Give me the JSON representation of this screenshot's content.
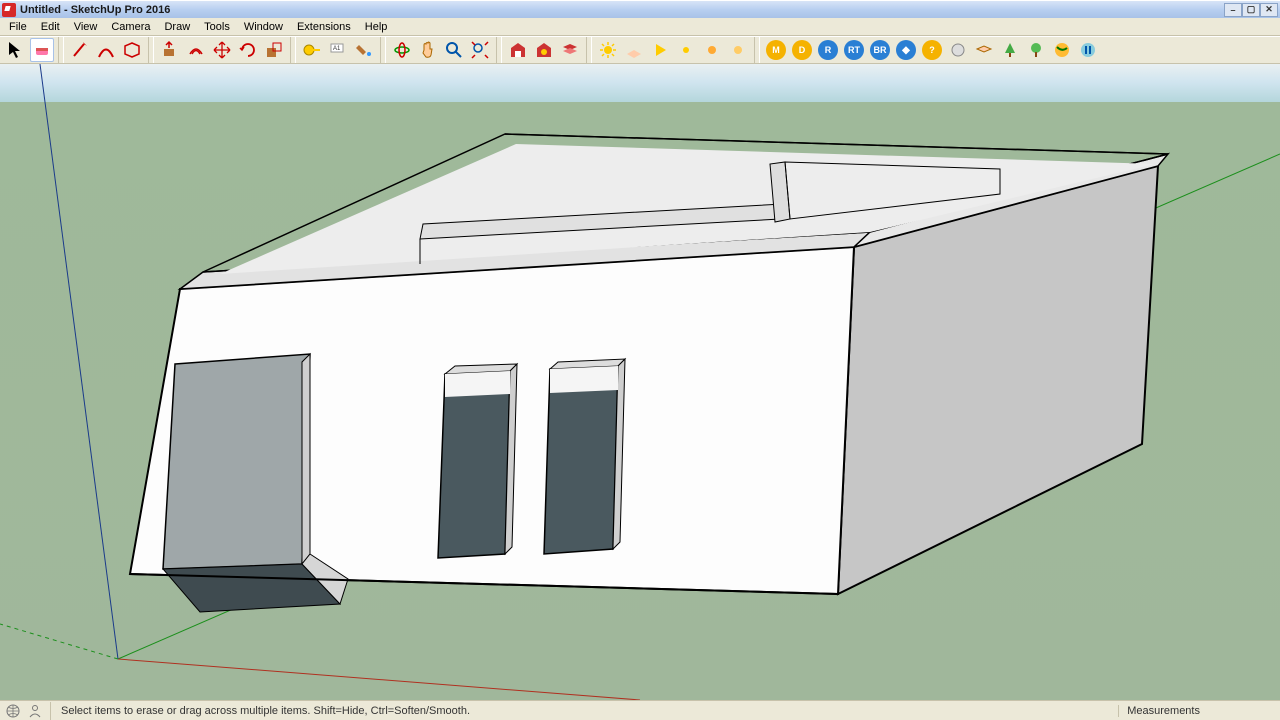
{
  "window": {
    "title": "Untitled - SketchUp Pro 2016",
    "buttons": {
      "minimize": "–",
      "maximize": "▢",
      "close": "✕"
    }
  },
  "menu": {
    "items": [
      "File",
      "Edit",
      "View",
      "Camera",
      "Draw",
      "Tools",
      "Window",
      "Extensions",
      "Help"
    ]
  },
  "tools": {
    "select": "Select",
    "eraser": "Eraser",
    "line": "Lines",
    "arc": "Arcs",
    "shape": "Shapes",
    "pushpull": "Push/Pull",
    "offset": "Offset",
    "move": "Move",
    "rotate": "Rotate",
    "scale": "Scale",
    "tape": "Tape Measure",
    "text": "Text",
    "paint": "Paint Bucket",
    "orbit": "Orbit",
    "pan": "Pan",
    "zoom": "Zoom",
    "zoomext": "Zoom Extents",
    "warehouse": "3D Warehouse",
    "extwh": "Extension Warehouse",
    "layers": "Layers",
    "sun": "Shadows",
    "play": "Play",
    "smallsun": "Sun",
    "timesmall": "Time",
    "globe": "Globe",
    "m": "M",
    "d": "D",
    "r": "R",
    "rt": "RT",
    "br": "BR",
    "dq": "D?",
    "help": "?",
    "sphere": "Sphere",
    "layer": "Layer",
    "trees": "Trees",
    "tree2": "Tree",
    "earth": "Earth",
    "pause": "Pause"
  },
  "status": {
    "hint": "Select items to erase or drag across multiple items. Shift=Hide, Ctrl=Soften/Smooth.",
    "measurements_label": "Measurements"
  },
  "active_tool": "eraser",
  "colors": {
    "ground": "#9fb99a",
    "sky": "#cfe4ef",
    "wall_light": "#fdfdfd",
    "wall_shade": "#d6d6d6",
    "wall_dark": "#4a5a5f",
    "toolbar": "#ece9d8"
  }
}
